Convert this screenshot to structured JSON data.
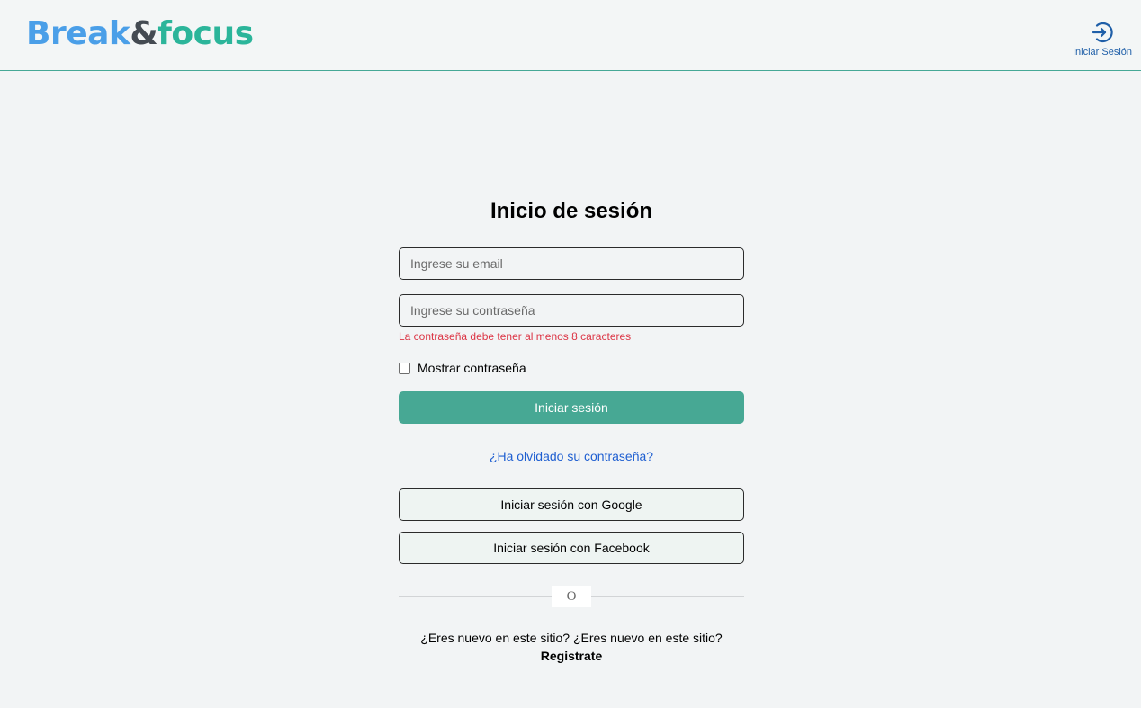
{
  "header": {
    "logo_part1": "Break",
    "logo_part2": "&",
    "logo_part3": "focus",
    "login_icon": "login-arrow-icon",
    "login_label": "Iniciar Sesión"
  },
  "form": {
    "title": "Inicio de sesión",
    "email_placeholder": "Ingrese su email",
    "email_value": "",
    "password_placeholder": "Ingrese su contraseña",
    "password_value": "",
    "password_error": "La contraseña debe tener al menos 8 caracteres",
    "show_password_label": "Mostrar contraseña",
    "show_password_checked": false,
    "submit_label": "Iniciar sesión",
    "forgot_label": "¿Ha olvidado su contraseña?",
    "google_label": "Iniciar sesión con Google",
    "facebook_label": "Iniciar sesión con Facebook",
    "divider_text": "O",
    "new_user_question": "¿Eres nuevo en este sitio? ¿Eres nuevo en este sitio?",
    "register_label": "Registrate"
  },
  "colors": {
    "accent": "#47a894",
    "logo_blue": "#4a9fe8",
    "logo_dark": "#444b52",
    "logo_green": "#2bb59a",
    "error": "#dc3545",
    "link": "#1f5fd1"
  }
}
